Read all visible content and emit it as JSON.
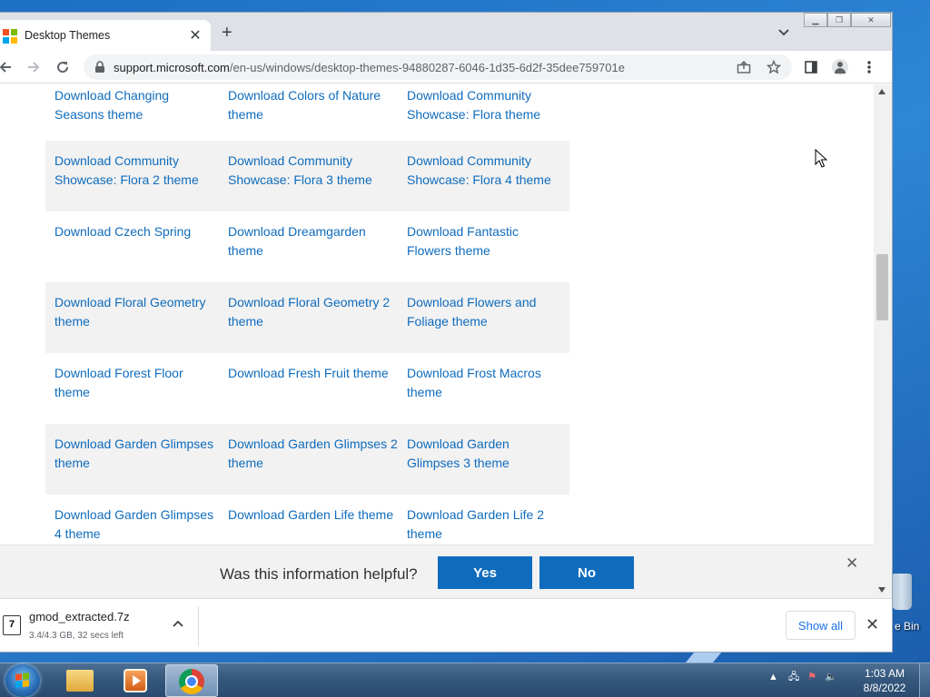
{
  "browser": {
    "tab_title": "Desktop Themes",
    "url_host": "support.microsoft.com",
    "url_path": "/en-us/windows/desktop-themes-94880287-6046-1d35-6d2f-35dee759701e"
  },
  "themes": {
    "rows": [
      [
        "Download Changing Seasons theme",
        "Download Colors of Nature theme",
        "Download Community Showcase: Flora theme"
      ],
      [
        "Download Community Showcase: Flora 2 theme",
        "Download Community Showcase: Flora 3 theme",
        "Download Community Showcase: Flora 4 theme"
      ],
      [
        "Download Czech Spring",
        "Download Dreamgarden theme",
        "Download Fantastic Flowers theme"
      ],
      [
        "Download Floral Geometry theme",
        "Download Floral Geometry 2 theme",
        "Download Flowers and Foliage theme"
      ],
      [
        "Download Forest Floor theme",
        "Download Fresh Fruit theme",
        "Download Frost Macros theme"
      ],
      [
        "Download Garden Glimpses theme",
        "Download Garden Glimpses 2 theme",
        "Download Garden Glimpses 3 theme"
      ],
      [
        "Download Garden Glimpses 4 theme",
        "Download Garden Life theme",
        "Download Garden Life 2 theme"
      ]
    ]
  },
  "feedback": {
    "question": "Was this information helpful?",
    "yes_label": "Yes",
    "no_label": "No"
  },
  "download": {
    "file_name": "gmod_extracted.7z",
    "status": "3.4/4.3 GB, 32 secs left",
    "show_all_label": "Show all"
  },
  "desktop": {
    "recycle_bin_label": "e Bin"
  },
  "taskbar": {
    "time": "1:03 AM",
    "date": "8/8/2022"
  },
  "colors": {
    "link": "#0f6cbd",
    "button": "#0f6cbd",
    "ms_red": "#f25022",
    "ms_green": "#7fba00",
    "ms_blue": "#00a4ef",
    "ms_yellow": "#ffb900"
  }
}
